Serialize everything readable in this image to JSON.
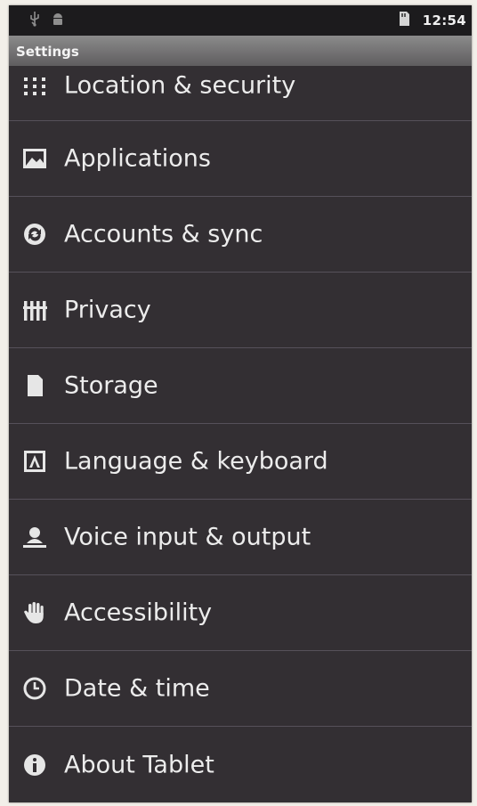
{
  "status_bar": {
    "time": "12:54",
    "left_icons": [
      "usb-icon",
      "android-debug-icon"
    ],
    "right_icons": [
      "sd-card-icon"
    ]
  },
  "title_bar": {
    "title": "Settings"
  },
  "settings_items": [
    {
      "label": "Location & security",
      "icon": "location-grid-icon"
    },
    {
      "label": "Applications",
      "icon": "applications-icon"
    },
    {
      "label": "Accounts & sync",
      "icon": "sync-icon"
    },
    {
      "label": "Privacy",
      "icon": "privacy-icon"
    },
    {
      "label": "Storage",
      "icon": "storage-icon"
    },
    {
      "label": "Language & keyboard",
      "icon": "keyboard-icon"
    },
    {
      "label": "Voice input & output",
      "icon": "voice-icon"
    },
    {
      "label": "Accessibility",
      "icon": "hand-icon"
    },
    {
      "label": "Date & time",
      "icon": "clock-icon"
    },
    {
      "label": "About Tablet",
      "icon": "info-icon"
    }
  ],
  "colors": {
    "background": "#332f33",
    "status_bar": "#1c1b1d",
    "divider": "#56515a",
    "text": "#ececec"
  }
}
